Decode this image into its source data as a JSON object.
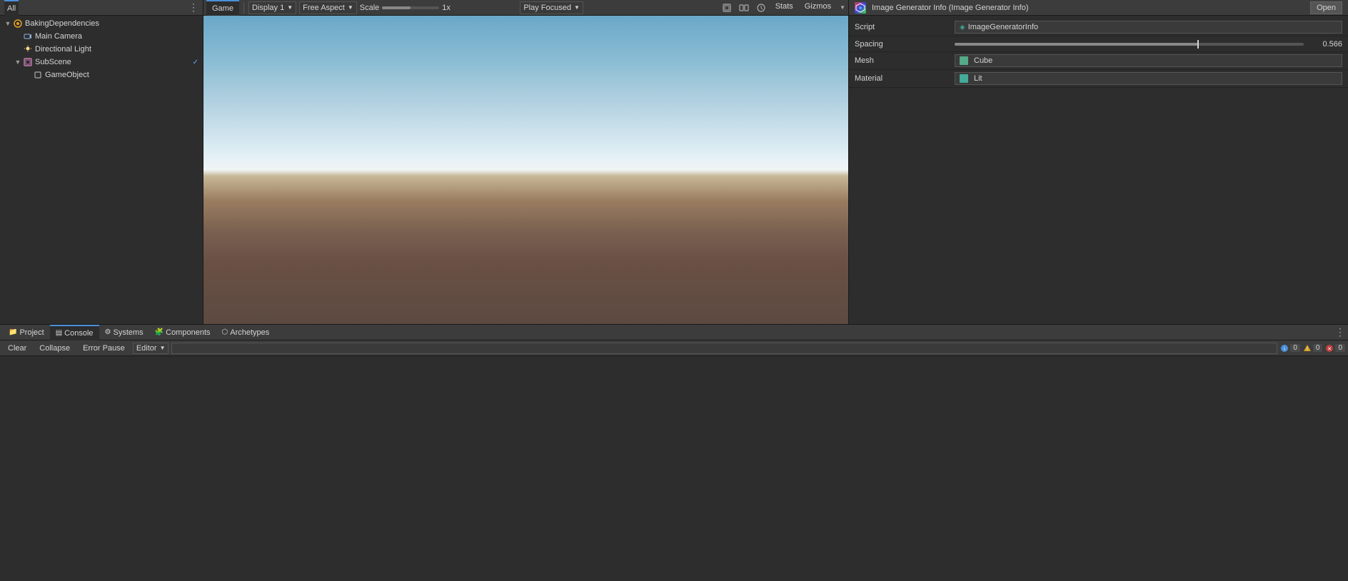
{
  "window": {
    "title": "Image Generator Info (Image Generator Info)"
  },
  "hierarchy": {
    "tab_label": "All",
    "items": [
      {
        "id": "baking-deps",
        "label": "BakingDependencies",
        "indent": 0,
        "icon": "scene",
        "expanded": true,
        "has_check": false
      },
      {
        "id": "main-camera",
        "label": "Main Camera",
        "indent": 1,
        "icon": "camera",
        "expanded": false,
        "has_check": false
      },
      {
        "id": "dir-light",
        "label": "Directional Light",
        "indent": 1,
        "icon": "light",
        "expanded": false,
        "has_check": false
      },
      {
        "id": "subscene",
        "label": "SubScene",
        "indent": 1,
        "icon": "subscene",
        "expanded": true,
        "has_check": true
      },
      {
        "id": "gameobject",
        "label": "GameObject",
        "indent": 2,
        "icon": "gameobj",
        "expanded": false,
        "has_check": false
      }
    ]
  },
  "game_view": {
    "tab_label": "Game",
    "display_label": "Display 1",
    "aspect_label": "Free Aspect",
    "scale_label": "Scale",
    "scale_min": "1x",
    "play_label": "Play Focused",
    "stats_label": "Stats",
    "gizmos_label": "Gizmos"
  },
  "inspector": {
    "title": "Image Generator Info (Image Generator Info)",
    "open_btn": "Open",
    "rows": [
      {
        "label": "Script",
        "value_type": "script",
        "value": "ImageGeneratorInfo"
      },
      {
        "label": "Spacing",
        "value_type": "slider",
        "value": "0.566"
      },
      {
        "label": "Mesh",
        "value_type": "asset",
        "value": "Cube",
        "icon": "mesh"
      },
      {
        "label": "Material",
        "value_type": "asset",
        "value": "Lit",
        "icon": "mat"
      }
    ]
  },
  "bottom": {
    "tabs": [
      {
        "id": "project",
        "label": "Project",
        "icon": "📁"
      },
      {
        "id": "console",
        "label": "Console",
        "icon": "📋",
        "active": true
      },
      {
        "id": "systems",
        "label": "Systems",
        "icon": "⚙"
      },
      {
        "id": "components",
        "label": "Components",
        "icon": "🧩"
      },
      {
        "id": "archetypes",
        "label": "Archetypes",
        "icon": "🏗"
      }
    ],
    "console": {
      "clear_label": "Clear",
      "collapse_label": "Collapse",
      "error_pause_label": "Error Pause",
      "editor_label": "Editor",
      "search_placeholder": "",
      "info_count": "0",
      "warn_count": "0",
      "error_count": "0"
    }
  }
}
